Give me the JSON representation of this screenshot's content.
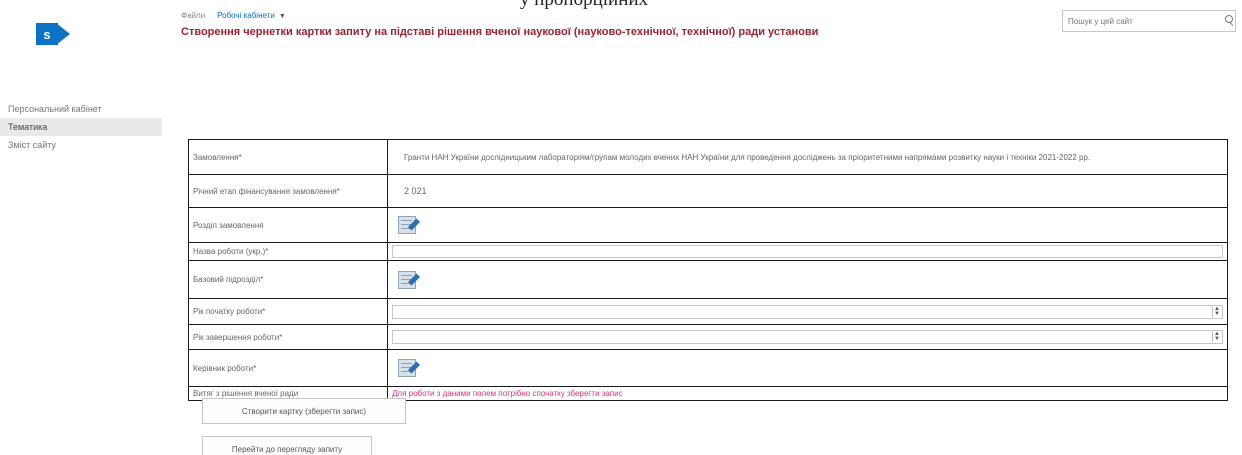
{
  "partial_top_text": "у пропорційних",
  "site": {
    "logo_letter": "s"
  },
  "left_nav": {
    "items": [
      {
        "label": "Персональний кабінет"
      },
      {
        "label": "Тематика"
      },
      {
        "label": "Зміст сайту"
      }
    ]
  },
  "breadcrumb": {
    "items": [
      "Файли",
      "Робочі кабінети"
    ],
    "chevron": "▼"
  },
  "page_title": "Створення чернетки картки запиту на підставі рішення вченої наукової (науково-технічної, технічної) ради установи",
  "search": {
    "placeholder": "Пошук у цей сайт"
  },
  "form": {
    "rows": [
      {
        "label": "Замовлення*",
        "value": "Гранти НАН України дослідницьким лабораторіям/групам молодих вчених НАН України для проведення досліджень за пріоритетними напрямами розвитку науки і техніки 2021-2022 рр."
      },
      {
        "label": "Річний етап фінансування замовлення*",
        "value": "2 021"
      },
      {
        "label": "Розділ замовлення"
      },
      {
        "label": "Назва роботи (укр.)*"
      },
      {
        "label": "Базовий підрозділ*"
      },
      {
        "label": "Рік початку роботи*"
      },
      {
        "label": "Рік завершення роботи*"
      },
      {
        "label": "Керівник роботи*"
      },
      {
        "label": "Витяг з рішення вченої ради",
        "value": "Для роботи з даними полем потрібно спочатку зберегти запис"
      }
    ]
  },
  "buttons": {
    "create": "Створити картку (зберегти запис)",
    "goto": "Перейти до перегляду запиту"
  }
}
